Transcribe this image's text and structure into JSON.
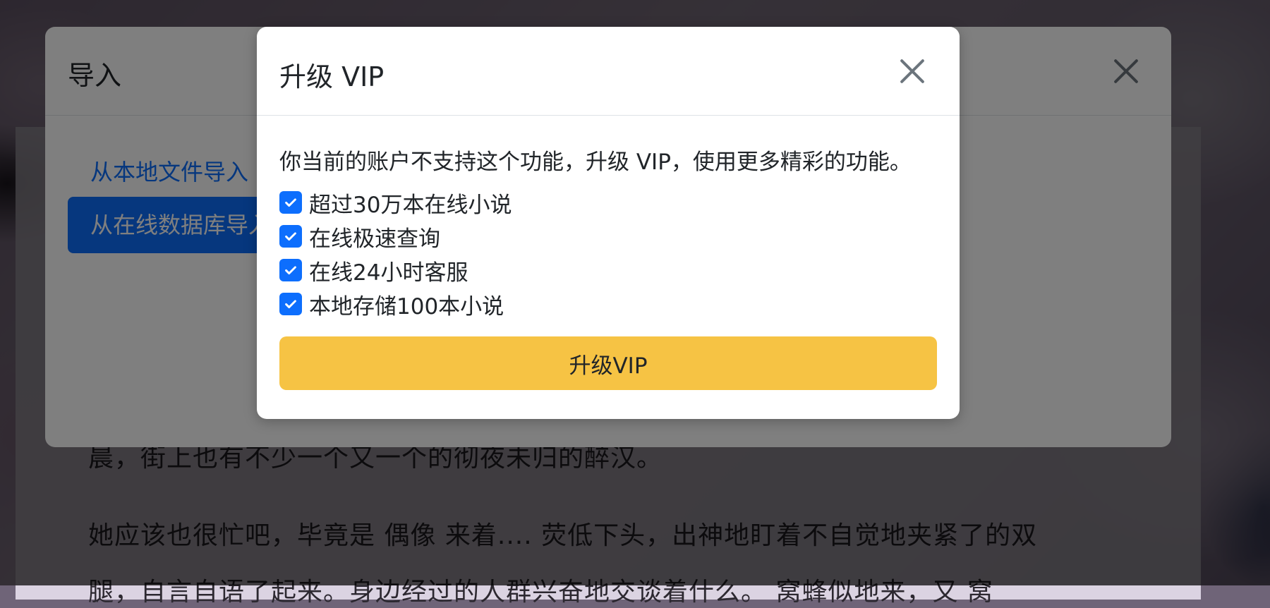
{
  "reader": {
    "line_1": "晨，街上也有不少一个又一个的彻夜未归的醉汉。",
    "line_2": "她应该也很忙吧，毕竟是 偶像 来着.... 荧低下头，出神地盯着不自觉地夹紧了的双",
    "line_3": "腿，自言自语了起来。身边经过的人群兴奋地交谈着什么。 窝蜂似地来，又 窝"
  },
  "import_dialog": {
    "title": "导入",
    "tabs": [
      {
        "label": "从本地文件导入",
        "active": false
      },
      {
        "label": "从在线数据库导入",
        "active": true
      }
    ]
  },
  "vip_dialog": {
    "title": "升级 VIP",
    "description": "你当前的账户不支持这个功能，升级 VIP，使用更多精彩的功能。",
    "features": [
      {
        "label": "超过30万本在线小说",
        "checked": true
      },
      {
        "label": "在线极速查询",
        "checked": true
      },
      {
        "label": "在线24小时客服",
        "checked": true
      },
      {
        "label": "本地存储100本小说",
        "checked": true
      }
    ],
    "upgrade_button": "升级VIP"
  },
  "colors": {
    "primary": "#0d6efd",
    "warning": "#f6c344",
    "overlay": "#000000"
  },
  "icons": {
    "close": "close-icon",
    "check": "check-icon"
  }
}
